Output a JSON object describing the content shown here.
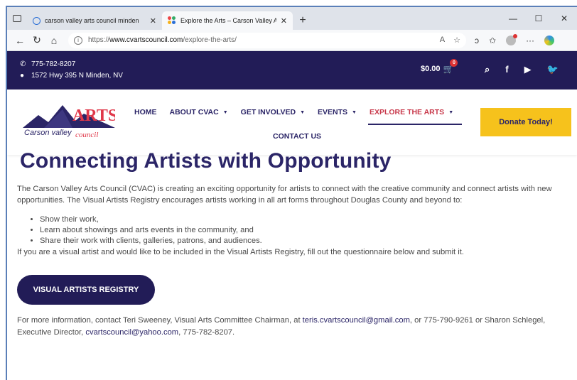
{
  "browser": {
    "tabs": [
      {
        "title": "carson valley arts council minden",
        "close": "✕"
      },
      {
        "title": "Explore the Arts – Carson Valley A",
        "close": "✕"
      }
    ],
    "new_tab": "+",
    "window_controls": {
      "minimize": "—",
      "maximize": "☐",
      "close": "✕"
    },
    "url_protocol": "https://",
    "url_host": "www.cvartscouncil.com",
    "url_path": "/explore-the-arts/"
  },
  "topbar": {
    "phone": "775-782-8207",
    "address": "1572 Hwy 395 N Minden, NV",
    "cart_total": "$0.00",
    "cart_count": "0",
    "colors": {
      "background": "#221c57"
    }
  },
  "nav": {
    "items": [
      {
        "label": "HOME"
      },
      {
        "label": "ABOUT CVAC"
      },
      {
        "label": "GET INVOLVED"
      },
      {
        "label": "EVENTS"
      },
      {
        "label": "EXPLORE THE ARTS"
      }
    ],
    "contact": "CONTACT US",
    "donate": "Donate Today!"
  },
  "logo": {
    "arts": "ARTS",
    "carson_valley": "Carson valley",
    "council": "council"
  },
  "main": {
    "title": "Connecting Artists with Opportunity",
    "intro": "The Carson Valley Arts Council (CVAC) is creating an exciting opportunity for artists to connect with the creative community and connect artists with new opportunities. The Visual Artists Registry encourages artists working in all art forms throughout Douglas County and beyond to:",
    "bullets": [
      "Show their work,",
      "Learn about showings and arts events in the community, and",
      "Share their work with clients, galleries, patrons, and audiences."
    ],
    "after": "If you are a visual artist and would like to be included in the Visual Artists Registry, fill out the questionnaire below and submit it.",
    "button": "VISUAL ARTISTS REGISTRY",
    "more_1": "For more information, contact Teri Sweeney, Visual Arts Committee Chairman, at ",
    "email_1": "teris.cvartscouncil@gmail.com",
    "more_2": ", or 775-790-9261 or Sharon Schlegel, Executive Director, ",
    "email_2": "cvartscouncil@yahoo.com",
    "more_3": ", 775-782-8207."
  }
}
